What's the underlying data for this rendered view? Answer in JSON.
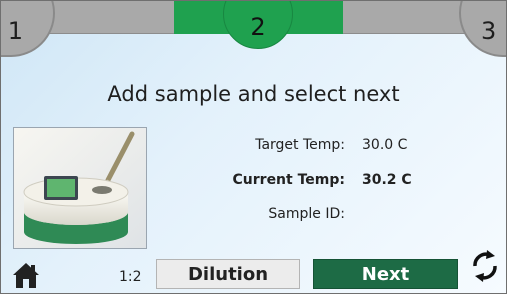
{
  "steps": [
    {
      "label": "1",
      "state": "inactive"
    },
    {
      "label": "2",
      "state": "active"
    },
    {
      "label": "3",
      "state": "inactive"
    }
  ],
  "instruction": "Add sample and select next",
  "fields": {
    "target_temp_label": "Target Temp:",
    "target_temp_value": "30.0 C",
    "current_temp_label": "Current Temp:",
    "current_temp_value": "30.2 C",
    "sample_id_label": "Sample ID:",
    "sample_id_value": ""
  },
  "footer": {
    "home_icon": "home-icon",
    "ratio_text": "1:2",
    "dilution_label": "Dilution",
    "next_label": "Next",
    "refresh_icon": "refresh-icon"
  },
  "colors": {
    "active_step": "#1fa14f",
    "inactive_step": "#a9a9a9",
    "next_button": "#1d6b45",
    "dilution_button": "#ececec"
  }
}
